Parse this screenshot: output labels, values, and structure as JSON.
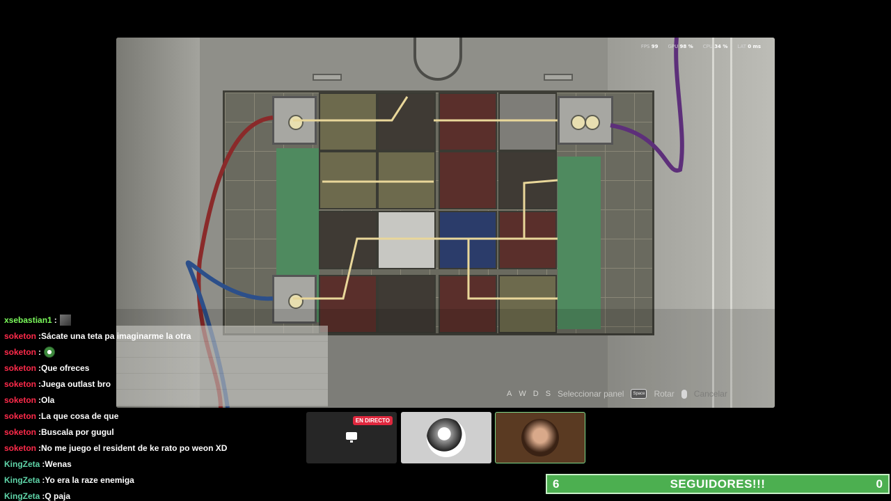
{
  "hud": {
    "fps_label": "FPS",
    "fps_value": "99",
    "gpu_label": "GPU",
    "gpu_value": "98 %",
    "cpu_label": "CPU",
    "cpu_value": "34 %",
    "lat_label": "LAT",
    "lat_value": "0 ms"
  },
  "controls": {
    "keys": [
      "A",
      "W",
      "D",
      "S"
    ],
    "select_panel": "Seleccionar panel",
    "space_key": "Space",
    "rotate": "Rotar",
    "cancel": "Cancelar"
  },
  "chat": {
    "messages": [
      {
        "user": "xsebastian1",
        "color": "#7cfc5c",
        "text": "",
        "emote": "gray"
      },
      {
        "user": "soketon",
        "color": "#ff2a4a",
        "text": "Sácate una teta pa imaginarme la otra",
        "emote": ""
      },
      {
        "user": "soketon",
        "color": "#ff2a4a",
        "text": "",
        "emote": "green"
      },
      {
        "user": "soketon",
        "color": "#ff2a4a",
        "text": "Que ofreces",
        "emote": ""
      },
      {
        "user": "soketon",
        "color": "#ff2a4a",
        "text": "Juega outlast bro",
        "emote": ""
      },
      {
        "user": "soketon",
        "color": "#ff2a4a",
        "text": "Ola",
        "emote": ""
      },
      {
        "user": "soketon",
        "color": "#ff2a4a",
        "text": "La que cosa de que",
        "emote": ""
      },
      {
        "user": "soketon",
        "color": "#ff2a4a",
        "text": "Buscala por gugul",
        "emote": ""
      },
      {
        "user": "soketon",
        "color": "#ff2a4a",
        "text": "No me juego el resident de ke rato po weon XD",
        "emote": ""
      },
      {
        "user": "KingZeta",
        "color": "#5fd4a8",
        "text": "Wenas",
        "emote": ""
      },
      {
        "user": "KingZeta",
        "color": "#5fd4a8",
        "text": "Yo era la raze enemiga",
        "emote": ""
      },
      {
        "user": "KingZeta",
        "color": "#5fd4a8",
        "text": "Q paja",
        "emote": ""
      }
    ]
  },
  "participants": {
    "live_badge": "EN DIRECTO"
  },
  "followers": {
    "current": "6",
    "label": "SEGUIDORES!!!",
    "goal": "0",
    "color": "#4caf50"
  }
}
